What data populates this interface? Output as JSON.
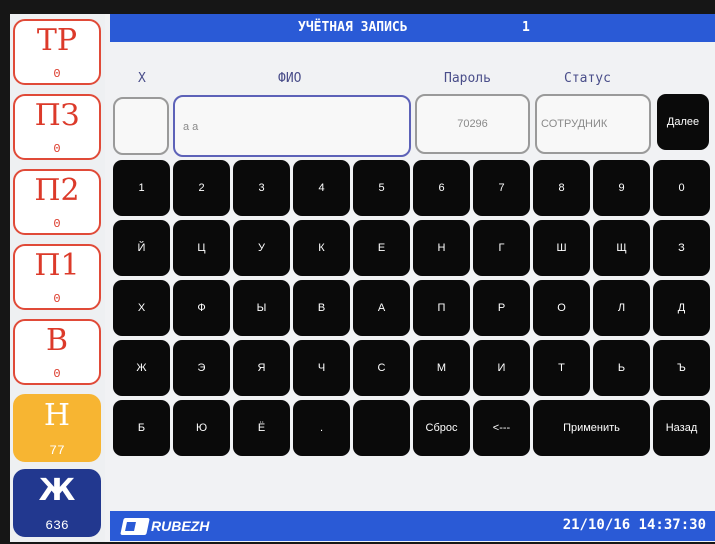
{
  "header": {
    "title": "УЧЁТНАЯ ЗАПИСЬ",
    "number": "1"
  },
  "columns": {
    "x": "Х",
    "name": "ФИО",
    "password": "Пароль",
    "status": "Статус"
  },
  "fields": {
    "x_value": "",
    "name_value": "а а",
    "password_value": "70296",
    "status_value": "СОТРУДНИК"
  },
  "next_label": "Далее",
  "sidebar": [
    {
      "label": "ТР",
      "count": "0"
    },
    {
      "label": "ПЗ",
      "count": "0"
    },
    {
      "label": "П2",
      "count": "0"
    },
    {
      "label": "П1",
      "count": "0"
    },
    {
      "label": "В",
      "count": "0"
    },
    {
      "label": "Н",
      "count": "77"
    },
    {
      "label": "Ж",
      "count": "636"
    }
  ],
  "keyboard": {
    "row1": [
      "1",
      "2",
      "3",
      "4",
      "5",
      "6",
      "7",
      "8",
      "9",
      "0"
    ],
    "row2": [
      "Й",
      "Ц",
      "У",
      "К",
      "Е",
      "Н",
      "Г",
      "Ш",
      "Щ",
      "З"
    ],
    "row3": [
      "Х",
      "Ф",
      "Ы",
      "В",
      "А",
      "П",
      "Р",
      "О",
      "Л",
      "Д"
    ],
    "row4": [
      "Ж",
      "Э",
      "Я",
      "Ч",
      "С",
      "М",
      "И",
      "Т",
      "Ь",
      "Ъ"
    ],
    "row5": [
      "Б",
      "Ю",
      "Ё",
      ".",
      "",
      "Сброс",
      "<---",
      "Применить",
      "Назад"
    ]
  },
  "footer": {
    "logo": "RUBEZH",
    "datetime": "21/10/16 14:37:30"
  },
  "colors": {
    "accent": "#2a5ad6",
    "alarm": "#dc3a2a",
    "warning": "#f7b532",
    "journal": "#22388f",
    "key": "#0a0a0a"
  }
}
